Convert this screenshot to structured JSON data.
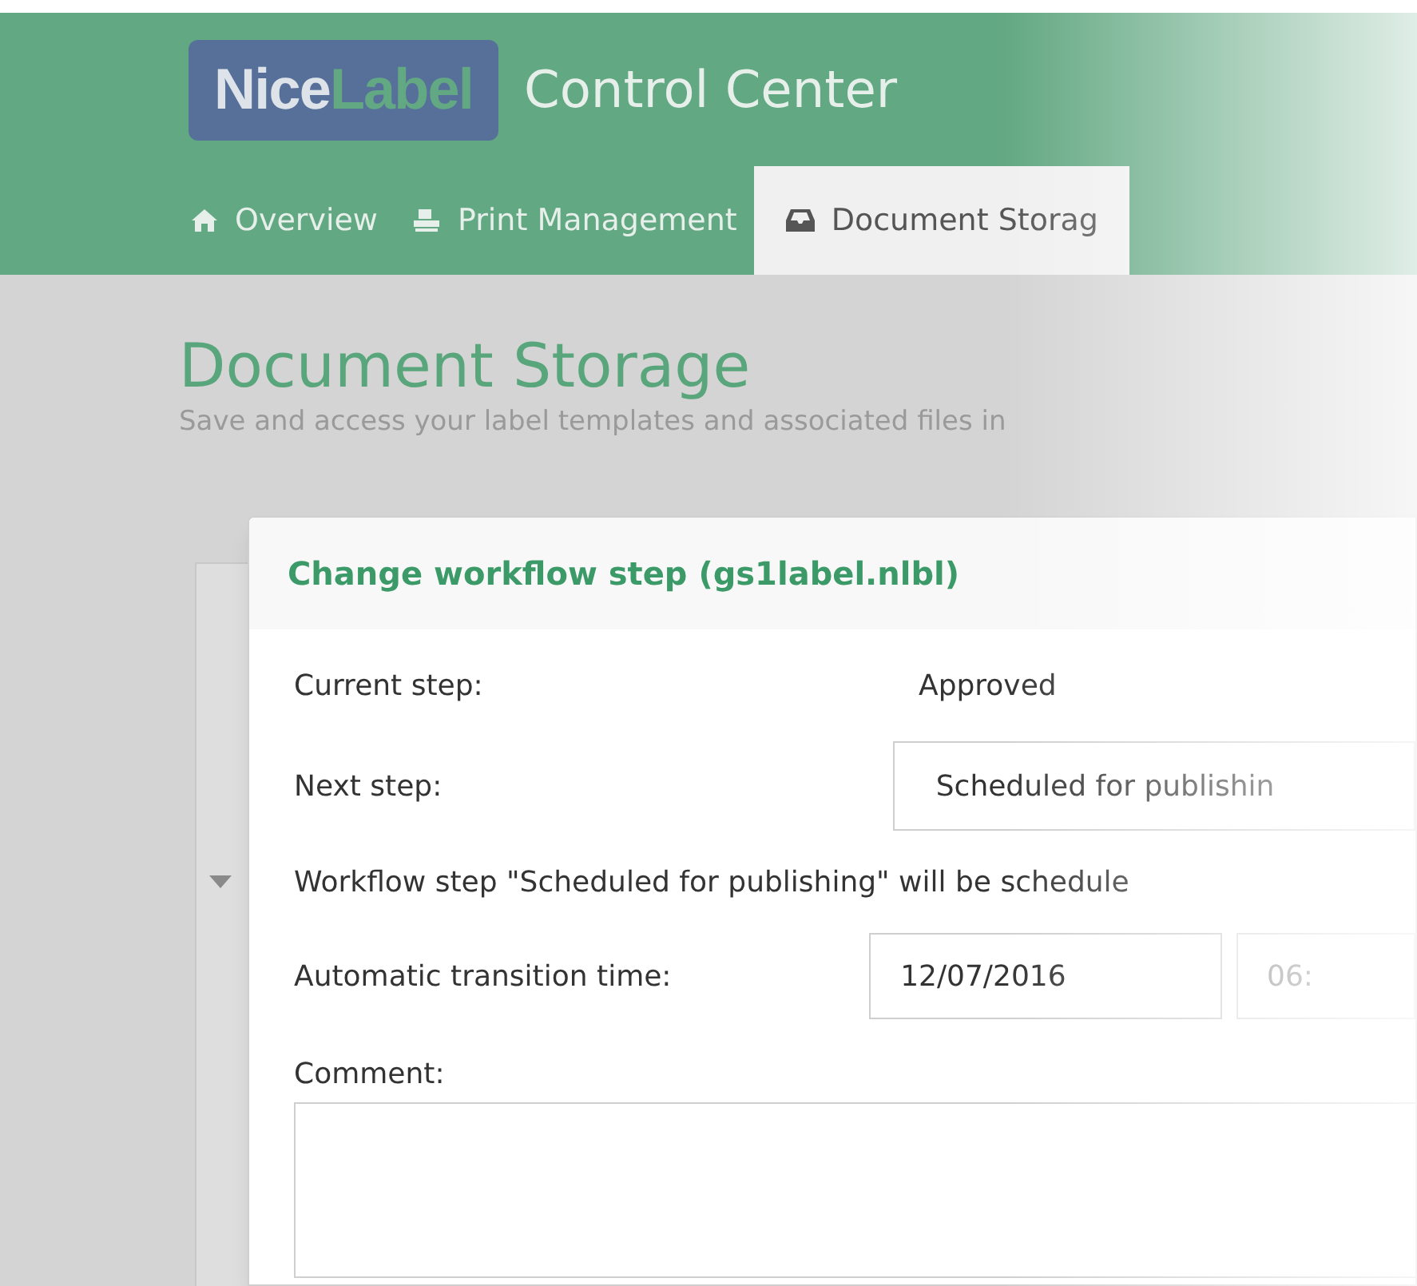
{
  "header": {
    "logo": {
      "part_1": "Nice",
      "part_2": "Label"
    },
    "title": "Control Center"
  },
  "tabs": [
    {
      "label": "Overview",
      "selected": false
    },
    {
      "label": "Print Management",
      "selected": false
    },
    {
      "label": "Document Storag",
      "selected": true
    }
  ],
  "page": {
    "title": "Document Storage",
    "subtitle": "Save and access your label templates and associated files in"
  },
  "dialog": {
    "title": "Change workflow step (gs1label.nlbl)",
    "current_step": {
      "label": "Current step:",
      "value": "Approved"
    },
    "next_step": {
      "label": "Next step:",
      "value": "Scheduled for publishin"
    },
    "info": "Workflow step \"Scheduled for publishing\" will be schedule",
    "transition": {
      "label": "Automatic transition time:",
      "date": "12/07/2016",
      "time": "06:"
    },
    "comment": {
      "label": "Comment:"
    }
  }
}
